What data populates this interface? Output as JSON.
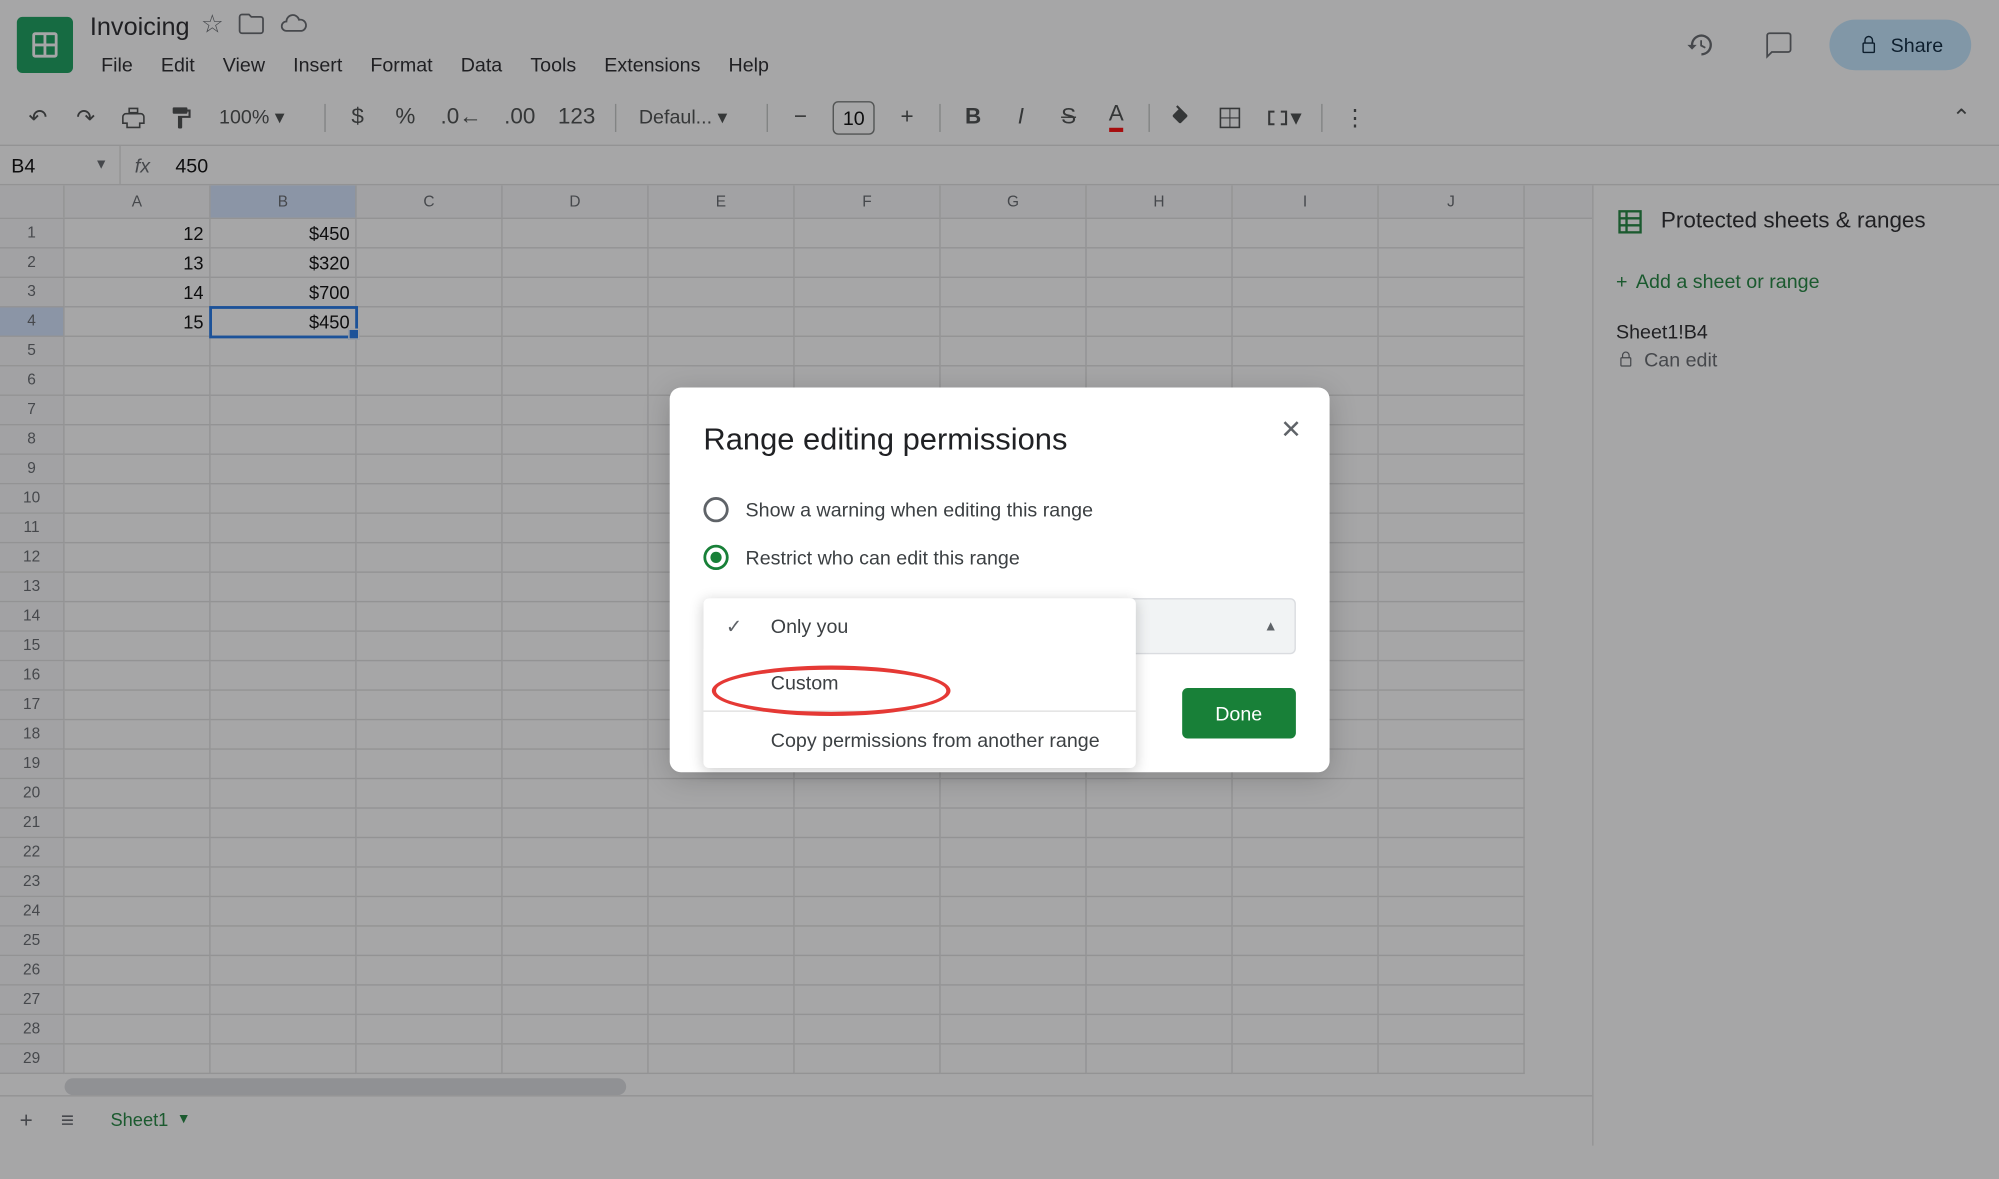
{
  "doc_title": "Invoicing",
  "menus": [
    "File",
    "Edit",
    "View",
    "Insert",
    "Format",
    "Data",
    "Tools",
    "Extensions",
    "Help"
  ],
  "share_label": "Share",
  "zoom": "100%",
  "font_name": "Defaul...",
  "font_size": "10",
  "name_box": "B4",
  "formula_value": "450",
  "columns": [
    "A",
    "B",
    "C",
    "D",
    "E",
    "F",
    "G",
    "H",
    "I",
    "J"
  ],
  "selected_col_index": 1,
  "selected_row_index": 3,
  "row_count": 29,
  "cells": {
    "r0": {
      "A": "12",
      "B": "$450"
    },
    "r1": {
      "A": "13",
      "B": "$320"
    },
    "r2": {
      "A": "14",
      "B": "$700"
    },
    "r3": {
      "A": "15",
      "B": "$450"
    }
  },
  "sheet_tab": "Sheet1",
  "side_panel": {
    "title": "Protected sheets & ranges",
    "add_label": "Add a sheet or range",
    "range_title": "Sheet1!B4",
    "range_sub": "Can edit"
  },
  "modal": {
    "title": "Range editing permissions",
    "option_warning": "Show a warning when editing this range",
    "option_restrict": "Restrict who can edit this range",
    "dropdown_only_you": "Only you",
    "dropdown_custom": "Custom",
    "dropdown_copy": "Copy permissions from another range",
    "done": "Done"
  },
  "toolbar_format_number": "123"
}
